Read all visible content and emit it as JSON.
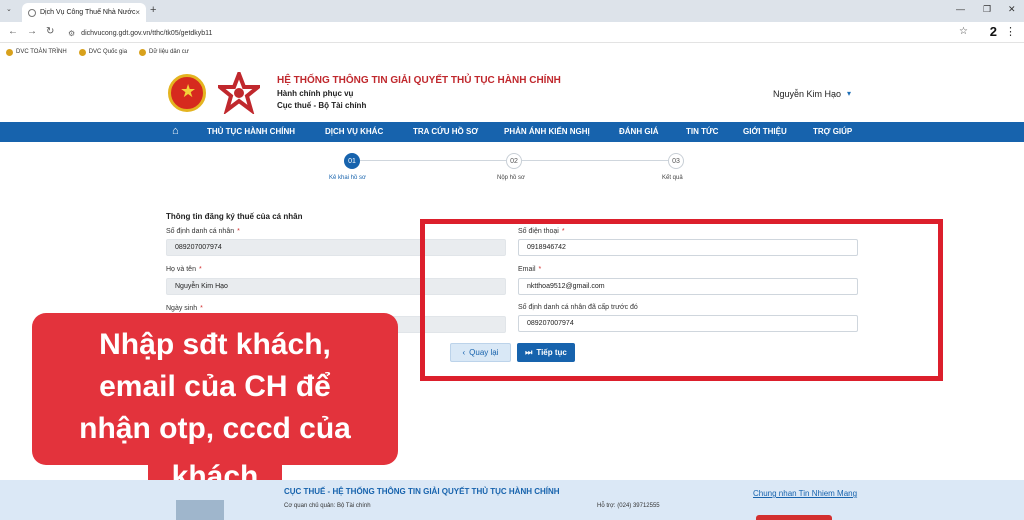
{
  "browser": {
    "tab_title": "Dịch Vụ Công Thuế Nhà Nước",
    "tab_close": "×",
    "new_tab": "+",
    "tab_menu": "⌄",
    "url": "dichvucong.gdt.gov.vn/tthc/tk05/getdkyb11",
    "profile_number": "2",
    "bookmarks": [
      "DVC TOÀN TRÌNH",
      "DVC Quốc gia",
      "Dữ liệu dân cư"
    ]
  },
  "site": {
    "title": "HỆ THỐNG THÔNG TIN GIẢI QUYẾT THỦ TỤC HÀNH CHÍNH",
    "subtitle1": "Hành chính phục vụ",
    "subtitle2": "Cục thuế - Bộ Tài chính",
    "user_name": "Nguyễn Kim Hạo",
    "user_caret": "▾"
  },
  "navbar": {
    "items": [
      "THỦ TỤC HÀNH CHÍNH",
      "DỊCH VỤ KHÁC",
      "TRA CỨU HỒ SƠ",
      "PHẢN ÁNH KIẾN NGHỊ",
      "ĐÁNH GIÁ",
      "TIN TỨC",
      "GIỚI THIỆU",
      "TRỢ GIÚP"
    ]
  },
  "steps": [
    {
      "num": "01",
      "label": "Kê khai hồ sơ",
      "active": true
    },
    {
      "num": "02",
      "label": "Nộp hồ sơ",
      "active": false
    },
    {
      "num": "03",
      "label": "Kết quả",
      "active": false
    }
  ],
  "form": {
    "section_title": "Thông tin đăng ký thuế của cá nhân",
    "id_label": "Số định danh cá nhân",
    "id_value": "089207007974",
    "name_label": "Họ và tên",
    "name_value": "Nguyễn Kim Hạo",
    "dob_label": "Ngày sinh",
    "phone_label": "Số điện thoại",
    "phone_value": "0918946742",
    "email_label": "Email",
    "email_value": "nktthoa9512@gmail.com",
    "prev_id_label": "Số định danh cá nhân đã cấp trước đó",
    "prev_id_value": "089207007974",
    "required_mark": "*",
    "back_button": "Quay lại",
    "next_button": "Tiếp tục"
  },
  "caption": {
    "lines": [
      "Nhập sđt khách,",
      "email của CH để",
      "nhận otp, cccd của",
      "khách"
    ]
  },
  "footer": {
    "title": "CỤC THUẾ - HỆ THỐNG THÔNG TIN GIẢI QUYẾT THỦ TỤC HÀNH CHÍNH",
    "agency": "Cơ quan chủ quản: Bộ Tài chính",
    "phone": "Hỗ trợ: (024) 39712555",
    "link": "Chung nhan Tin Nhiem Mang"
  },
  "colors": {
    "primary_blue": "#1763ad",
    "brand_red": "#c0282d",
    "highlight_red": "#dc1f2c",
    "caption_red": "#e3333c"
  }
}
